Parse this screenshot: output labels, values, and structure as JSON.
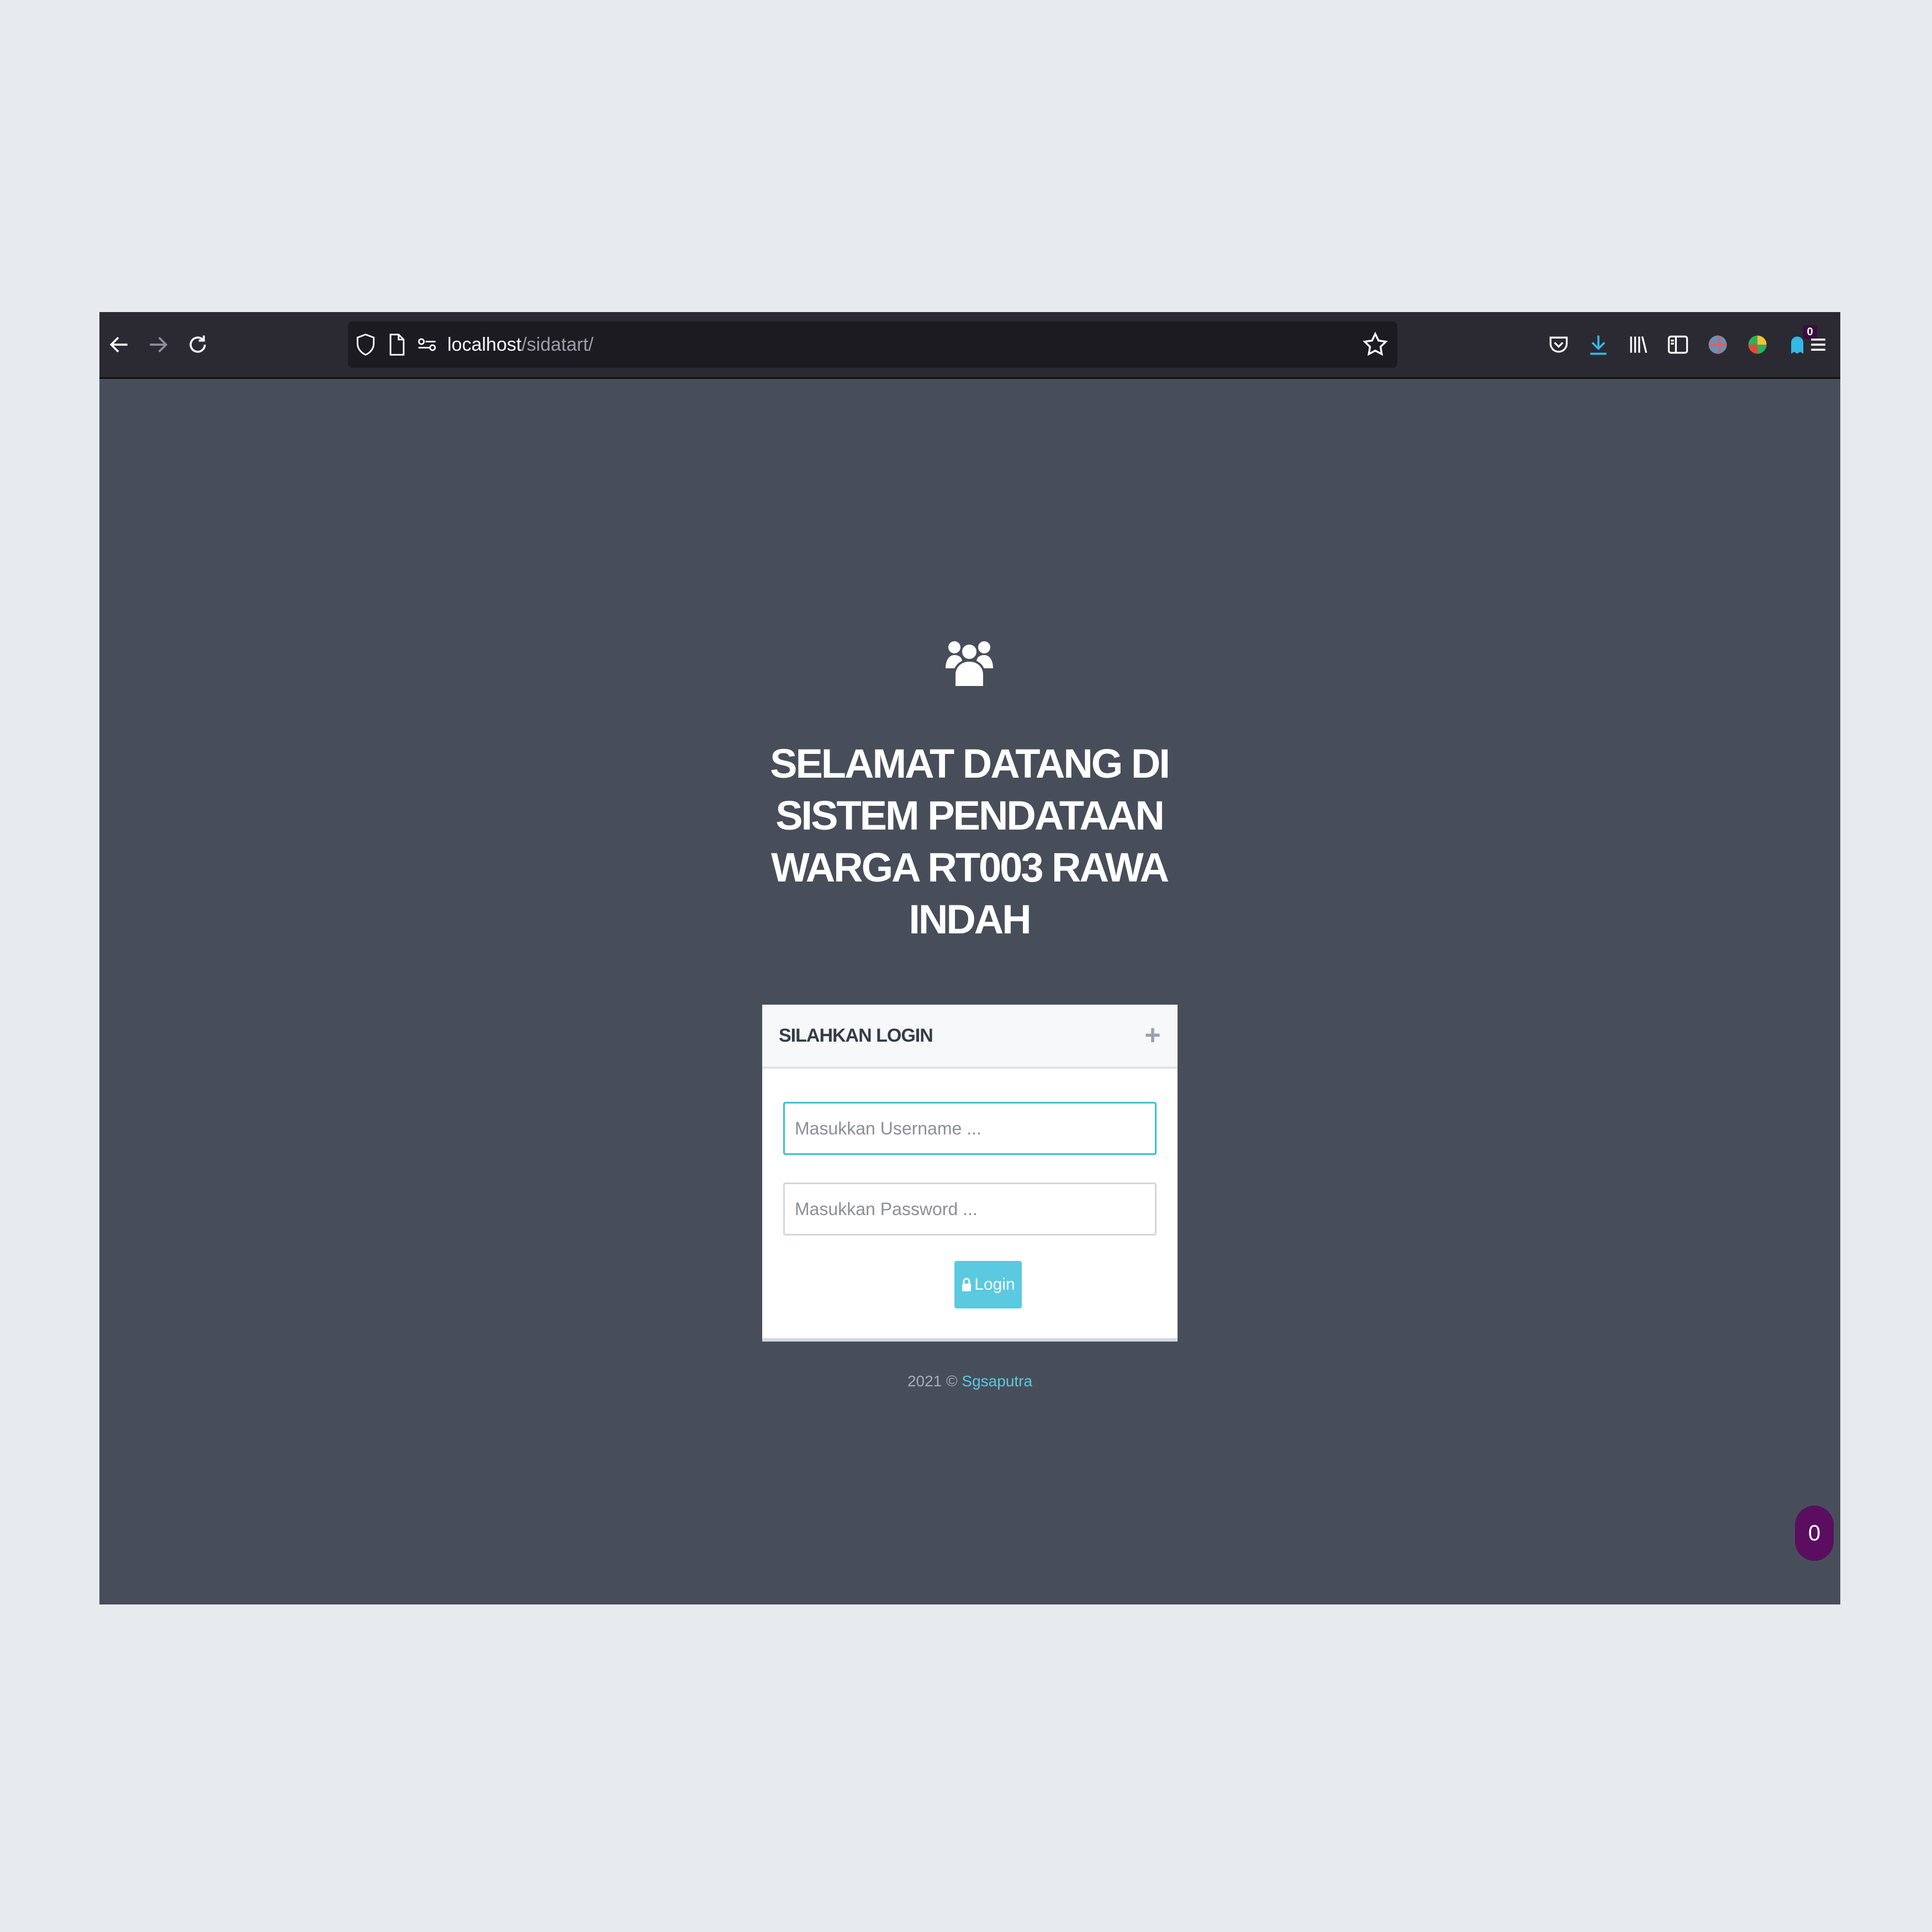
{
  "browser": {
    "url_host": "localhost",
    "url_path": "/sidatart/",
    "extension_badge": "0"
  },
  "page": {
    "title": "SELAMAT DATANG DI SISTEM PENDATAAN WARGA RT003 RAWA INDAH",
    "card_title": "SILAHKAN LOGIN",
    "username_placeholder": "Masukkan Username ...",
    "password_placeholder": "Masukkan Password ...",
    "login_label": "Login",
    "footer_prefix": "2021 © ",
    "footer_link": "Sgsaputra",
    "chat_count": "0"
  },
  "icons": {
    "back": "arrow-left-icon",
    "forward": "arrow-right-icon",
    "reload": "reload-icon",
    "tracking": "shield-icon",
    "page": "page-icon",
    "permissions": "permissions-icon",
    "bookmark": "star-icon",
    "pocket": "pocket-icon",
    "downloads": "download-icon",
    "library": "library-icon",
    "sidebar": "sidebar-icon",
    "menu": "hamburger-menu-icon",
    "header": "users-icon",
    "collapse": "plus-icon",
    "lock": "lock-icon"
  },
  "colors": {
    "background": "#474e5a",
    "accent": "#5bc9df",
    "chat": "#5b0e5f"
  }
}
